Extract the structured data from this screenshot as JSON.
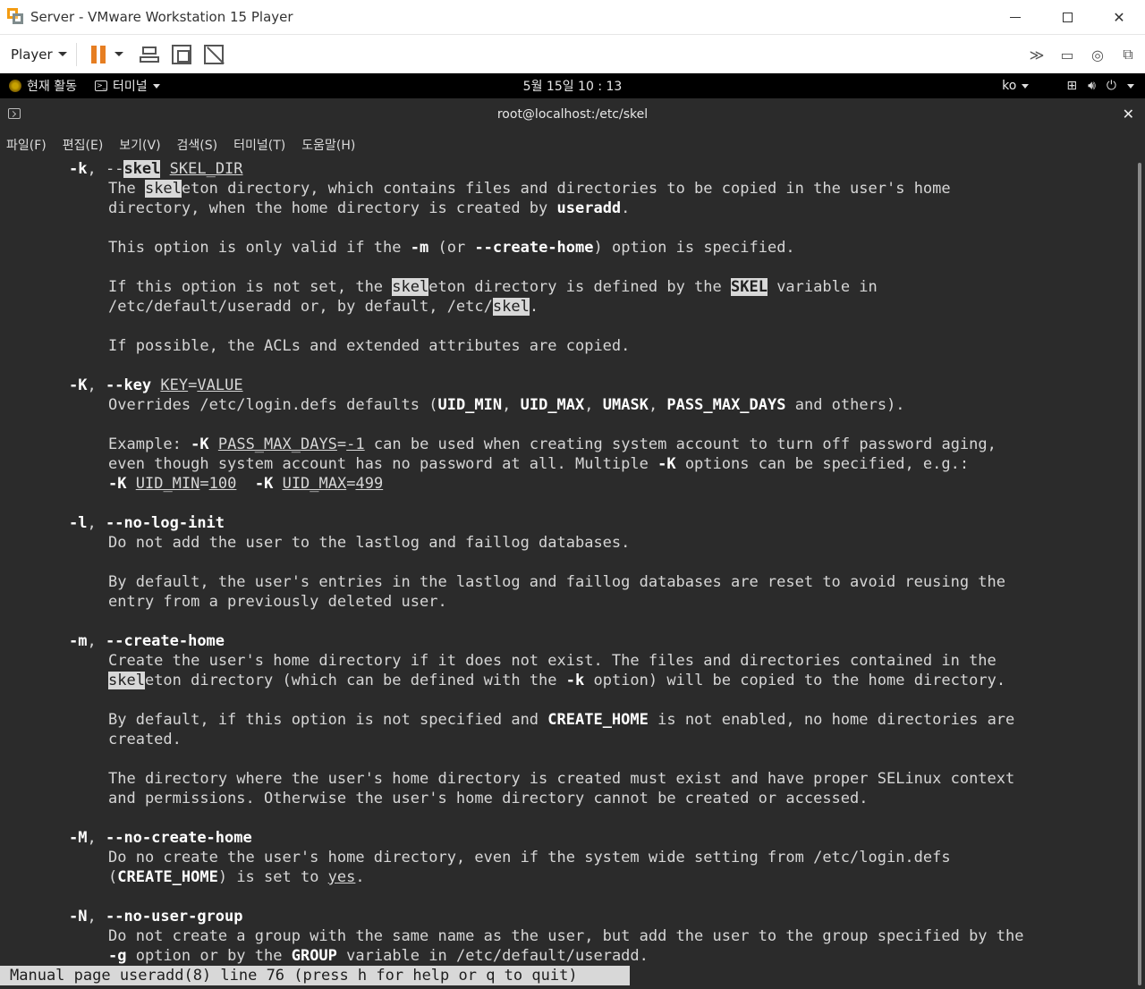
{
  "window": {
    "title": "Server - VMware Workstation 15 Player"
  },
  "toolbar": {
    "player_label": "Player"
  },
  "gnome": {
    "activities": "현재 활동",
    "app_menu": "터미널",
    "clock": "5월 15일  10 : 13",
    "lang": "ko"
  },
  "terminal": {
    "title": "root@localhost:/etc/skel",
    "menu": [
      "파일(F)",
      "편집(E)",
      "보기(V)",
      "검색(S)",
      "터미널(T)",
      "도움말(H)"
    ]
  },
  "manpage": {
    "status": "Manual page useradd(8) line 76 (press h for help or q to quit)",
    "lines": [
      {
        "indent": 1,
        "segs": [
          {
            "t": "-k",
            "s": "b"
          },
          {
            "t": ", --"
          },
          {
            "t": "skel",
            "s": "hlb"
          },
          {
            "t": " "
          },
          {
            "t": "SKEL_DIR",
            "s": "u"
          }
        ]
      },
      {
        "indent": 2,
        "segs": [
          {
            "t": "The "
          },
          {
            "t": "skel",
            "s": "hl"
          },
          {
            "t": "eton directory, which contains files and directories to be copied in the user's home"
          }
        ]
      },
      {
        "indent": 2,
        "segs": [
          {
            "t": "directory, when the home directory is created by "
          },
          {
            "t": "useradd",
            "s": "b"
          },
          {
            "t": "."
          }
        ]
      },
      {
        "indent": 2,
        "segs": []
      },
      {
        "indent": 2,
        "segs": [
          {
            "t": "This option is only valid if the "
          },
          {
            "t": "-m",
            "s": "b"
          },
          {
            "t": " (or "
          },
          {
            "t": "--create-home",
            "s": "b"
          },
          {
            "t": ") option is specified."
          }
        ]
      },
      {
        "indent": 2,
        "segs": []
      },
      {
        "indent": 2,
        "segs": [
          {
            "t": "If this option is not set, the "
          },
          {
            "t": "skel",
            "s": "hl"
          },
          {
            "t": "eton directory is defined by the "
          },
          {
            "t": "SKEL",
            "s": "hlb"
          },
          {
            "t": " variable in"
          }
        ]
      },
      {
        "indent": 2,
        "segs": [
          {
            "t": "/etc/default/useradd or, by default, /etc/"
          },
          {
            "t": "skel",
            "s": "hl"
          },
          {
            "t": "."
          }
        ]
      },
      {
        "indent": 2,
        "segs": []
      },
      {
        "indent": 2,
        "segs": [
          {
            "t": "If possible, the ACLs and extended attributes are copied."
          }
        ]
      },
      {
        "indent": 2,
        "segs": []
      },
      {
        "indent": 1,
        "segs": [
          {
            "t": "-K",
            "s": "b"
          },
          {
            "t": ", "
          },
          {
            "t": "--key",
            "s": "b"
          },
          {
            "t": " "
          },
          {
            "t": "KEY",
            "s": "u"
          },
          {
            "t": "="
          },
          {
            "t": "VALUE",
            "s": "u"
          }
        ]
      },
      {
        "indent": 2,
        "segs": [
          {
            "t": "Overrides /etc/login.defs defaults ("
          },
          {
            "t": "UID_MIN",
            "s": "b"
          },
          {
            "t": ", "
          },
          {
            "t": "UID_MAX",
            "s": "b"
          },
          {
            "t": ", "
          },
          {
            "t": "UMASK",
            "s": "b"
          },
          {
            "t": ", "
          },
          {
            "t": "PASS_MAX_DAYS",
            "s": "b"
          },
          {
            "t": " and others)."
          }
        ]
      },
      {
        "indent": 2,
        "segs": []
      },
      {
        "indent": 2,
        "segs": [
          {
            "t": "Example: "
          },
          {
            "t": "-K",
            "s": "b"
          },
          {
            "t": " "
          },
          {
            "t": "PASS_MAX_DAYS",
            "s": "u"
          },
          {
            "t": "="
          },
          {
            "t": "-1",
            "s": "u"
          },
          {
            "t": " can be used when creating system account to turn off password aging,"
          }
        ]
      },
      {
        "indent": 2,
        "segs": [
          {
            "t": "even though system account has no password at all. Multiple "
          },
          {
            "t": "-K",
            "s": "b"
          },
          {
            "t": " options can be specified, e.g.:"
          }
        ]
      },
      {
        "indent": 2,
        "segs": [
          {
            "t": "-K",
            "s": "b"
          },
          {
            "t": " "
          },
          {
            "t": "UID_MIN",
            "s": "u"
          },
          {
            "t": "="
          },
          {
            "t": "100",
            "s": "u"
          },
          {
            "t": "  "
          },
          {
            "t": "-K",
            "s": "b"
          },
          {
            "t": " "
          },
          {
            "t": "UID_MAX",
            "s": "u"
          },
          {
            "t": "="
          },
          {
            "t": "499",
            "s": "u"
          }
        ]
      },
      {
        "indent": 2,
        "segs": []
      },
      {
        "indent": 1,
        "segs": [
          {
            "t": "-l",
            "s": "b"
          },
          {
            "t": ", "
          },
          {
            "t": "--no-log-init",
            "s": "b"
          }
        ]
      },
      {
        "indent": 2,
        "segs": [
          {
            "t": "Do not add the user to the lastlog and faillog databases."
          }
        ]
      },
      {
        "indent": 2,
        "segs": []
      },
      {
        "indent": 2,
        "segs": [
          {
            "t": "By default, the user's entries in the lastlog and faillog databases are reset to avoid reusing the"
          }
        ]
      },
      {
        "indent": 2,
        "segs": [
          {
            "t": "entry from a previously deleted user."
          }
        ]
      },
      {
        "indent": 2,
        "segs": []
      },
      {
        "indent": 1,
        "segs": [
          {
            "t": "-m",
            "s": "b"
          },
          {
            "t": ", "
          },
          {
            "t": "--create-home",
            "s": "b"
          }
        ]
      },
      {
        "indent": 2,
        "segs": [
          {
            "t": "Create the user's home directory if it does not exist. The files and directories contained in the"
          }
        ]
      },
      {
        "indent": 2,
        "segs": [
          {
            "t": "skel",
            "s": "hl"
          },
          {
            "t": "eton directory (which can be defined with the "
          },
          {
            "t": "-k",
            "s": "b"
          },
          {
            "t": " option) will be copied to the home directory."
          }
        ]
      },
      {
        "indent": 2,
        "segs": []
      },
      {
        "indent": 2,
        "segs": [
          {
            "t": "By default, if this option is not specified and "
          },
          {
            "t": "CREATE_HOME",
            "s": "b"
          },
          {
            "t": " is not enabled, no home directories are"
          }
        ]
      },
      {
        "indent": 2,
        "segs": [
          {
            "t": "created."
          }
        ]
      },
      {
        "indent": 2,
        "segs": []
      },
      {
        "indent": 2,
        "segs": [
          {
            "t": "The directory where the user's home directory is created must exist and have proper SELinux context"
          }
        ]
      },
      {
        "indent": 2,
        "segs": [
          {
            "t": "and permissions. Otherwise the user's home directory cannot be created or accessed."
          }
        ]
      },
      {
        "indent": 2,
        "segs": []
      },
      {
        "indent": 1,
        "segs": [
          {
            "t": "-M",
            "s": "b"
          },
          {
            "t": ", "
          },
          {
            "t": "--no-create-home",
            "s": "b"
          }
        ]
      },
      {
        "indent": 2,
        "segs": [
          {
            "t": "Do no create the user's home directory, even if the system wide setting from /etc/login.defs"
          }
        ]
      },
      {
        "indent": 2,
        "segs": [
          {
            "t": "("
          },
          {
            "t": "CREATE_HOME",
            "s": "b"
          },
          {
            "t": ") is set to "
          },
          {
            "t": "yes",
            "s": "u"
          },
          {
            "t": "."
          }
        ]
      },
      {
        "indent": 2,
        "segs": []
      },
      {
        "indent": 1,
        "segs": [
          {
            "t": "-N",
            "s": "b"
          },
          {
            "t": ", "
          },
          {
            "t": "--no-user-group",
            "s": "b"
          }
        ]
      },
      {
        "indent": 2,
        "segs": [
          {
            "t": "Do not create a group with the same name as the user, but add the user to the group specified by the"
          }
        ]
      },
      {
        "indent": 2,
        "segs": [
          {
            "t": "-g",
            "s": "b"
          },
          {
            "t": " option or by the "
          },
          {
            "t": "GROUP",
            "s": "b"
          },
          {
            "t": " variable in /etc/default/useradd."
          }
        ]
      }
    ]
  }
}
